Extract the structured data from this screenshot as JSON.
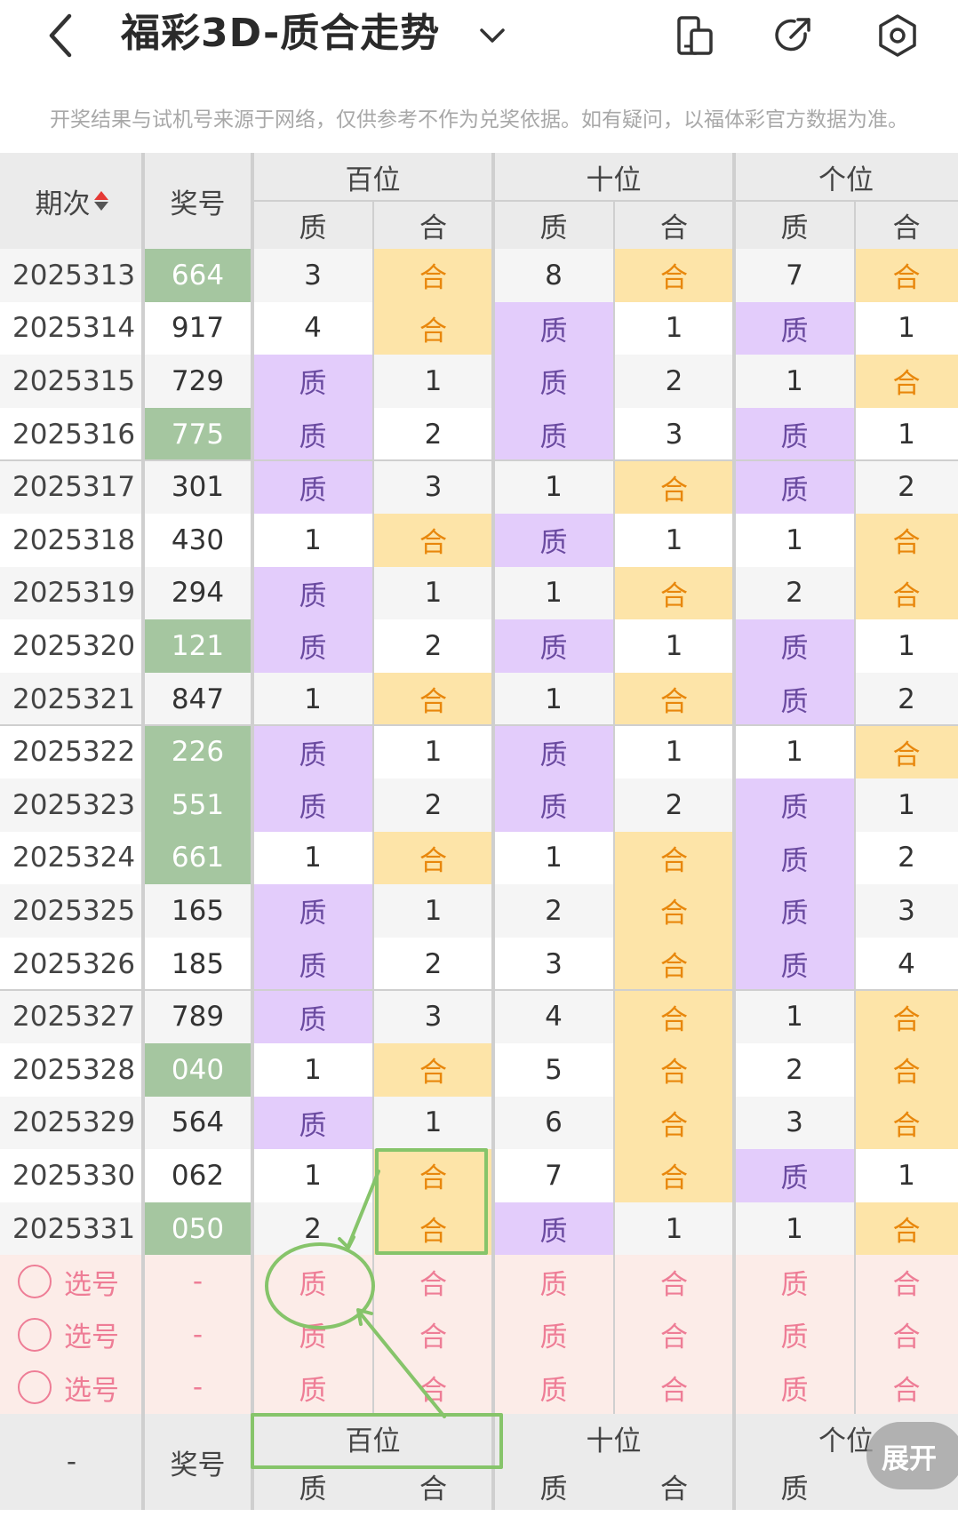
{
  "header": {
    "title": "福彩3D-质合走势",
    "notice": "开奖结果与试机号来源于网络，仅供参考不作为兑奖依据。如有疑问，以福体彩官方数据为准。"
  },
  "table": {
    "col_period": "期次",
    "col_number": "奖号",
    "groups": [
      "百位",
      "十位",
      "个位"
    ],
    "sub_labels": [
      "质",
      "合"
    ],
    "rows": [
      {
        "period": "2025313",
        "number": "664",
        "green": true,
        "cells": [
          "3",
          "合",
          "8",
          "合",
          "7",
          "合"
        ]
      },
      {
        "period": "2025314",
        "number": "917",
        "green": false,
        "cells": [
          "4",
          "合",
          "质",
          "1",
          "质",
          "1"
        ]
      },
      {
        "period": "2025315",
        "number": "729",
        "green": false,
        "cells": [
          "质",
          "1",
          "质",
          "2",
          "1",
          "合"
        ]
      },
      {
        "period": "2025316",
        "number": "775",
        "green": true,
        "cells": [
          "质",
          "2",
          "质",
          "3",
          "质",
          "1"
        ]
      },
      {
        "period": "2025317",
        "number": "301",
        "green": false,
        "cells": [
          "质",
          "3",
          "1",
          "合",
          "质",
          "2"
        ]
      },
      {
        "period": "2025318",
        "number": "430",
        "green": false,
        "cells": [
          "1",
          "合",
          "质",
          "1",
          "1",
          "合"
        ]
      },
      {
        "period": "2025319",
        "number": "294",
        "green": false,
        "cells": [
          "质",
          "1",
          "1",
          "合",
          "2",
          "合"
        ]
      },
      {
        "period": "2025320",
        "number": "121",
        "green": true,
        "cells": [
          "质",
          "2",
          "质",
          "1",
          "质",
          "1"
        ]
      },
      {
        "period": "2025321",
        "number": "847",
        "green": false,
        "cells": [
          "1",
          "合",
          "1",
          "合",
          "质",
          "2"
        ]
      },
      {
        "period": "2025322",
        "number": "226",
        "green": true,
        "cells": [
          "质",
          "1",
          "质",
          "1",
          "1",
          "合"
        ]
      },
      {
        "period": "2025323",
        "number": "551",
        "green": true,
        "cells": [
          "质",
          "2",
          "质",
          "2",
          "质",
          "1"
        ]
      },
      {
        "period": "2025324",
        "number": "661",
        "green": true,
        "cells": [
          "1",
          "合",
          "1",
          "合",
          "质",
          "2"
        ]
      },
      {
        "period": "2025325",
        "number": "165",
        "green": false,
        "cells": [
          "质",
          "1",
          "2",
          "合",
          "质",
          "3"
        ]
      },
      {
        "period": "2025326",
        "number": "185",
        "green": false,
        "cells": [
          "质",
          "2",
          "3",
          "合",
          "质",
          "4"
        ]
      },
      {
        "period": "2025327",
        "number": "789",
        "green": false,
        "cells": [
          "质",
          "3",
          "4",
          "合",
          "1",
          "合"
        ]
      },
      {
        "period": "2025328",
        "number": "040",
        "green": true,
        "cells": [
          "1",
          "合",
          "5",
          "合",
          "2",
          "合"
        ]
      },
      {
        "period": "2025329",
        "number": "564",
        "green": false,
        "cells": [
          "质",
          "1",
          "6",
          "合",
          "3",
          "合"
        ]
      },
      {
        "period": "2025330",
        "number": "062",
        "green": false,
        "cells": [
          "1",
          "合",
          "7",
          "合",
          "质",
          "1"
        ]
      },
      {
        "period": "2025331",
        "number": "050",
        "green": true,
        "cells": [
          "2",
          "合",
          "质",
          "1",
          "1",
          "合"
        ]
      }
    ],
    "pick_rows": [
      {
        "label": "选号",
        "number": "-",
        "cells": [
          "质",
          "合",
          "质",
          "合",
          "质",
          "合"
        ]
      },
      {
        "label": "选号",
        "number": "-",
        "cells": [
          "质",
          "合",
          "质",
          "合",
          "质",
          "合"
        ]
      },
      {
        "label": "选号",
        "number": "-",
        "cells": [
          "质",
          "合",
          "质",
          "合",
          "质",
          "合"
        ]
      }
    ],
    "footer": {
      "period": "-",
      "number_label": "奖号",
      "groups": [
        "百位",
        "十位",
        "个位"
      ],
      "sub_labels": [
        "质",
        "合",
        "质",
        "合",
        "质"
      ]
    }
  },
  "expand_label": "展开",
  "colors": {
    "zhi_bg": "#e3ccfb",
    "he_bg": "#fde4a8",
    "green_bg": "#a5c6a0",
    "pick_bg": "#fcece8",
    "annotation": "#86c46a"
  }
}
